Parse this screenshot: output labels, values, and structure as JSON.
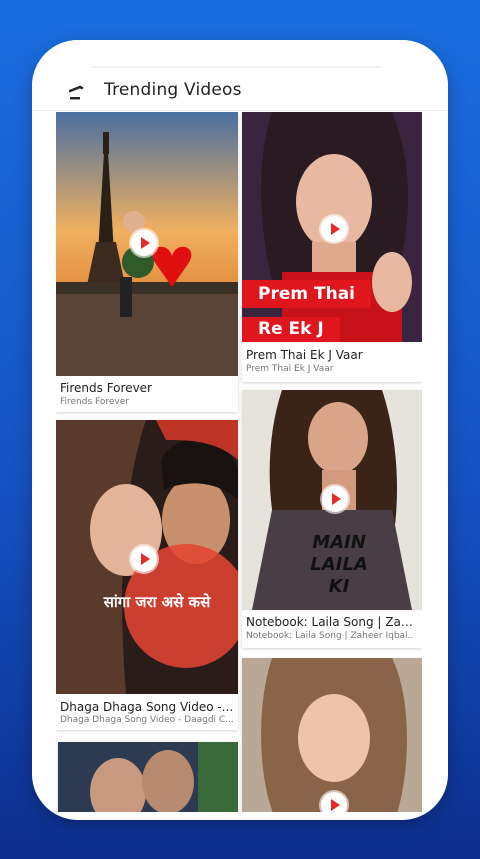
{
  "header": {
    "title": "Trending Videos",
    "back_icon": "back-arrow-icon"
  },
  "videos": [
    {
      "title": "Firends Forever",
      "subtitle": "Firends Forever"
    },
    {
      "title": "Prem Thai Ek J Vaar",
      "subtitle": "Prem Thai Ek J Vaar",
      "overlay_line1": "Prem Thai",
      "overlay_line2": "Re Ek J"
    },
    {
      "title": "Notebook: Laila Song | Zahe..",
      "subtitle": "Notebook: Laila Song | Zaheer Iqbal..",
      "overlay_lines": "MAIN\nLAILA\nKI"
    },
    {
      "title": "Dhaga Dhaga Song Video -...",
      "subtitle": "Dhaga Dhaga Song Video - Daagdi C...",
      "overlay_text": "सांगा जरा असे कसे"
    },
    {
      "title": "",
      "subtitle": ""
    },
    {
      "title": "",
      "subtitle": ""
    }
  ],
  "colors": {
    "background": "#1553c4",
    "play_icon": "#e52a2a",
    "prem_banner": "#e0161f"
  }
}
